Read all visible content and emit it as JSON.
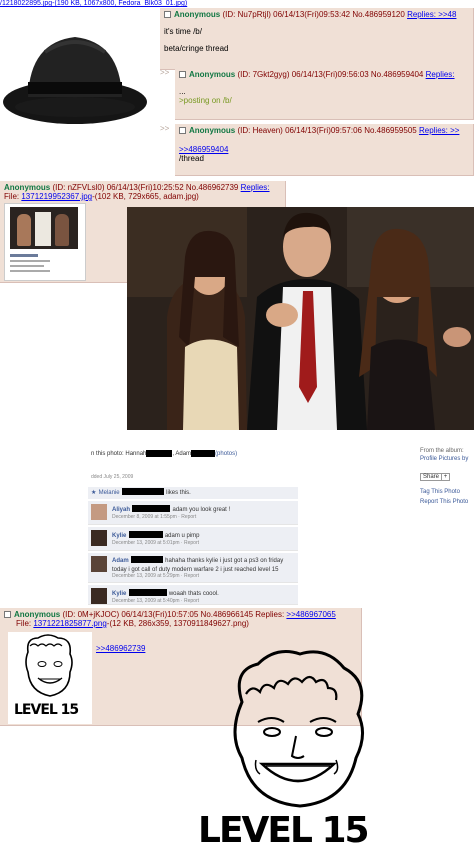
{
  "op_file": {
    "text": "/1218022895.jpg-(190 KB, 1067x800, Fedora_Blk03_01.jpg)"
  },
  "posts": [
    {
      "name": "Anonymous",
      "id": "(ID: Nu7pRtjl)",
      "date": "06/14/13(Fri)09:53:42",
      "no": "No.486959120",
      "replies": "Replies: >>48",
      "lines": [
        "it's time /b/",
        "",
        "beta/cringe thread"
      ]
    },
    {
      "name": "Anonymous",
      "id": "(ID: 7Gkt2gyg)",
      "date": "06/14/13(Fri)09:56:03",
      "no": "No.486959404",
      "replies": "Replies:",
      "lines": [
        "...",
        ">posting on /b/"
      ]
    },
    {
      "name": "Anonymous",
      "id": "(ID: Heaven)",
      "date": "06/14/13(Fri)09:57:06",
      "no": "No.486959505",
      "replies": "Replies: >>",
      "quote": ">>486959404",
      "lines": [
        "/thread"
      ]
    },
    {
      "name": "Anonymous",
      "id": "(ID: nZFVLsl0)",
      "date": "06/14/13(Fri)10:25:52",
      "no": "No.486962739",
      "replies": "Replies:",
      "file_label": "File:",
      "file_link": "1371219952367.jpg",
      "file_info": "-(102 KB, 729x665, adam.jpg)"
    },
    {
      "name": "Anonymous",
      "id": "(ID: 0M+jKJOC)",
      "date": "06/14/13(Fri)10:57:05",
      "no": "No.486966145",
      "replies": "Replies:",
      "replies_link": ">>486967065",
      "file_label": "File:",
      "file_link": "1371221825877.png",
      "file_info": "-(12 KB, 286x359, 1370911849627.png)",
      "quote": ">>486962739"
    }
  ],
  "fb": {
    "in_photo": "n this photo: Hannah",
    "adam": ", Adam",
    "photos": "(photos)",
    "from_album": "From the album:",
    "album": "Profile Pictures by",
    "added": "dded July 25, 2009",
    "share": "Share",
    "plus": "+",
    "tag": "Tag This Photo",
    "report": "Report This Photo",
    "likes_pre": "Melanie",
    "likes_post": "likes this.",
    "comments": [
      {
        "name": "Aliyah",
        "text": "adam you look great !",
        "time": "December 8, 2009 at 1:55pm · Report"
      },
      {
        "name": "Kylie",
        "text": "adam u pimp",
        "time": "December 13, 2009 at 5:01pm · Report"
      },
      {
        "name": "Adam",
        "text": "hahaha thanks kylie i just got a ps3 on friday today i got call of duty modern warfare 2 i just reached level 15",
        "time": "December 13, 2009 at 5:29pm · Report"
      },
      {
        "name": "Kylie",
        "text": "woaah thats coool.",
        "time": "December 13, 2009 at 5:40pm · Report"
      }
    ]
  },
  "drawings": {
    "small_caption": "LEVEL 15",
    "big_caption": "LEVEL 15"
  },
  "colors": {
    "post_bg": "#f0e0d6",
    "name": "#117743",
    "text": "#800000",
    "quote": "#789922",
    "link": "#0000ee"
  }
}
